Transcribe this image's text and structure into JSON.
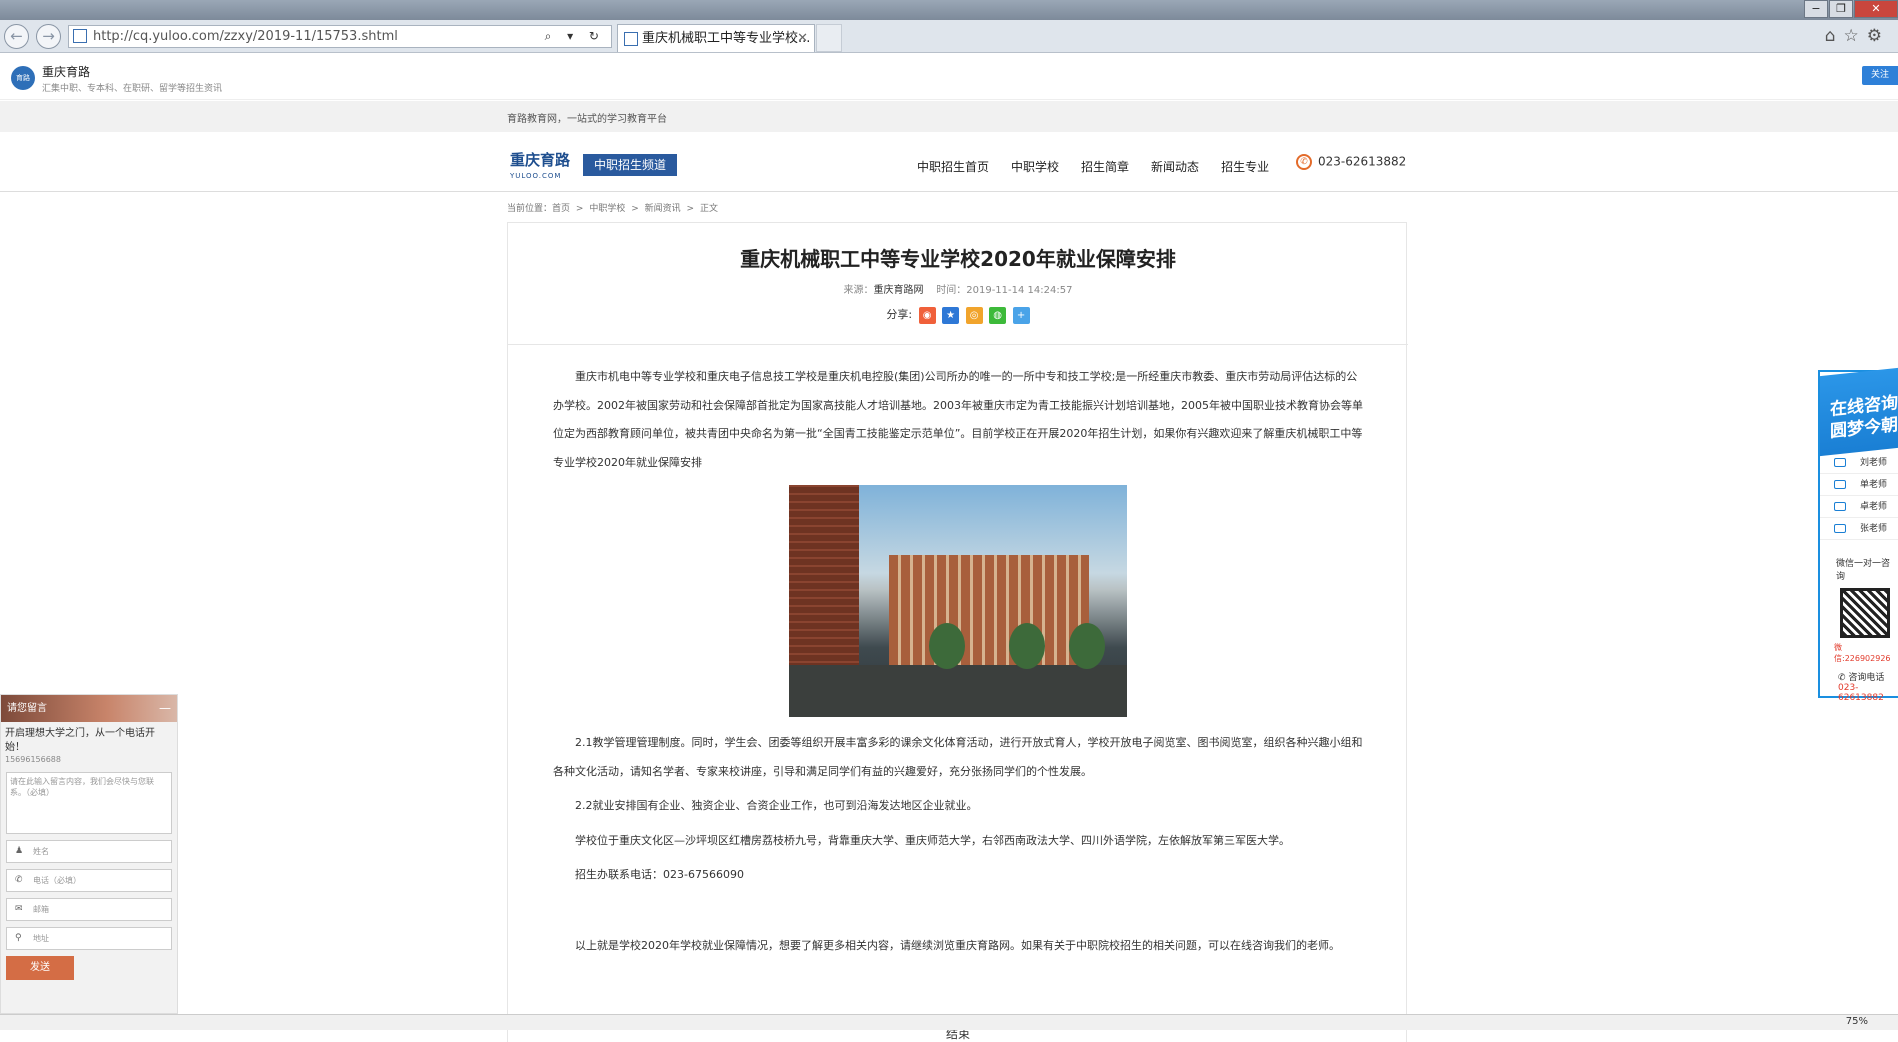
{
  "browser": {
    "url": "http://cq.yuloo.com/zzxy/2019-11/15753.shtml",
    "tab_title": "重庆机械职工中等专业学校...",
    "address_tools": "⌕ ▾ ↻",
    "zoom": "75%"
  },
  "site": {
    "logo_text": "育路",
    "name": "重庆育路",
    "subtitle": "汇集中职、专本科、在职研、留学等招生资讯",
    "follow_label": "关注"
  },
  "strip": {
    "text": "育路教育网，一站式的学习教育平台"
  },
  "header": {
    "brand": "重庆育路",
    "brand_sub": "YULOO.COM",
    "channel": "中职招生频道",
    "nav": [
      "中职招生首页",
      "中职学校",
      "招生简章",
      "新闻动态",
      "招生专业"
    ],
    "phone": "023-62613882"
  },
  "breadcrumb": [
    "当前位置：首页",
    ">",
    "中职学校",
    ">",
    "新闻资讯",
    ">",
    "正文"
  ],
  "article": {
    "title": "重庆机械职工中等专业学校2020年就业保障安排",
    "source_label": "来源：",
    "source": "重庆育路网",
    "time": "时间：2019-11-14 14:24:57",
    "share_label": "分享:",
    "paragraphs": [
      "重庆市机电中等专业学校和重庆电子信息技工学校是重庆机电控股(集团)公司所办的唯一的一所中专和技工学校;是一所经重庆市教委、重庆市劳动局评估达标的公办学校。2002年被国家劳动和社会保障部首批定为国家高技能人才培训基地。2003年被重庆市定为青工技能振兴计划培训基地，2005年被中国职业技术教育协会等单位定为西部教育顾问单位，被共青团中央命名为第一批“全国青工技能鉴定示范单位”。目前学校正在开展2020年招生计划，如果你有兴趣欢迎来了解重庆机械职工中等专业学校2020年就业保障安排",
      "2.1教学管理管理制度。同时，学生会、团委等组织开展丰富多彩的课余文化体育活动，进行开放式育人，学校开放电子阅览室、图书阅览室，组织各种兴趣小组和各种文化活动，请知名学者、专家来校讲座，引导和满足同学们有益的兴趣爱好，充分张扬同学们的个性发展。",
      "2.2就业安排国有企业、独资企业、合资企业工作，也可到沿海发达地区企业就业。",
      "学校位于重庆文化区—沙坪坝区红槽房荔枝桥九号，背靠重庆大学、重庆师范大学，右邻西南政法大学、四川外语学院，左依解放军第三军医大学。",
      "招生办联系电话：023-67566090",
      "以上就是学校2020年学校就业保障情况，想要了解更多相关内容，请继续浏览重庆育路网。如果有关于中职院校招生的相关问题，可以在线咨询我们的老师。"
    ],
    "end_mark": "结束"
  },
  "message_box": {
    "header": "请您留言",
    "minimize": "—",
    "slogan": "开启理想大学之门，从一个电话开始！",
    "number": "15696156688",
    "textarea_placeholder": "请在此输入留言内容，我们会尽快与您联系。（必填）",
    "fields": [
      "姓名",
      "电话（必填）",
      "邮箱",
      "地址"
    ],
    "send_label": "发送"
  },
  "consult": {
    "title_line1": "在线咨询",
    "title_line2": "圆梦今朝",
    "teachers": [
      "刘老师",
      "单老师",
      "卓老师",
      "张老师"
    ],
    "wechat_label": "微信一对一咨询",
    "wechat_id": "微信:226902926",
    "tel_label": "咨询电话",
    "tel": "023-62613882"
  },
  "colors": {
    "brand_blue": "#2a5a9e",
    "send_orange": "#d46d45",
    "consult_blue": "#1a8fe0"
  }
}
